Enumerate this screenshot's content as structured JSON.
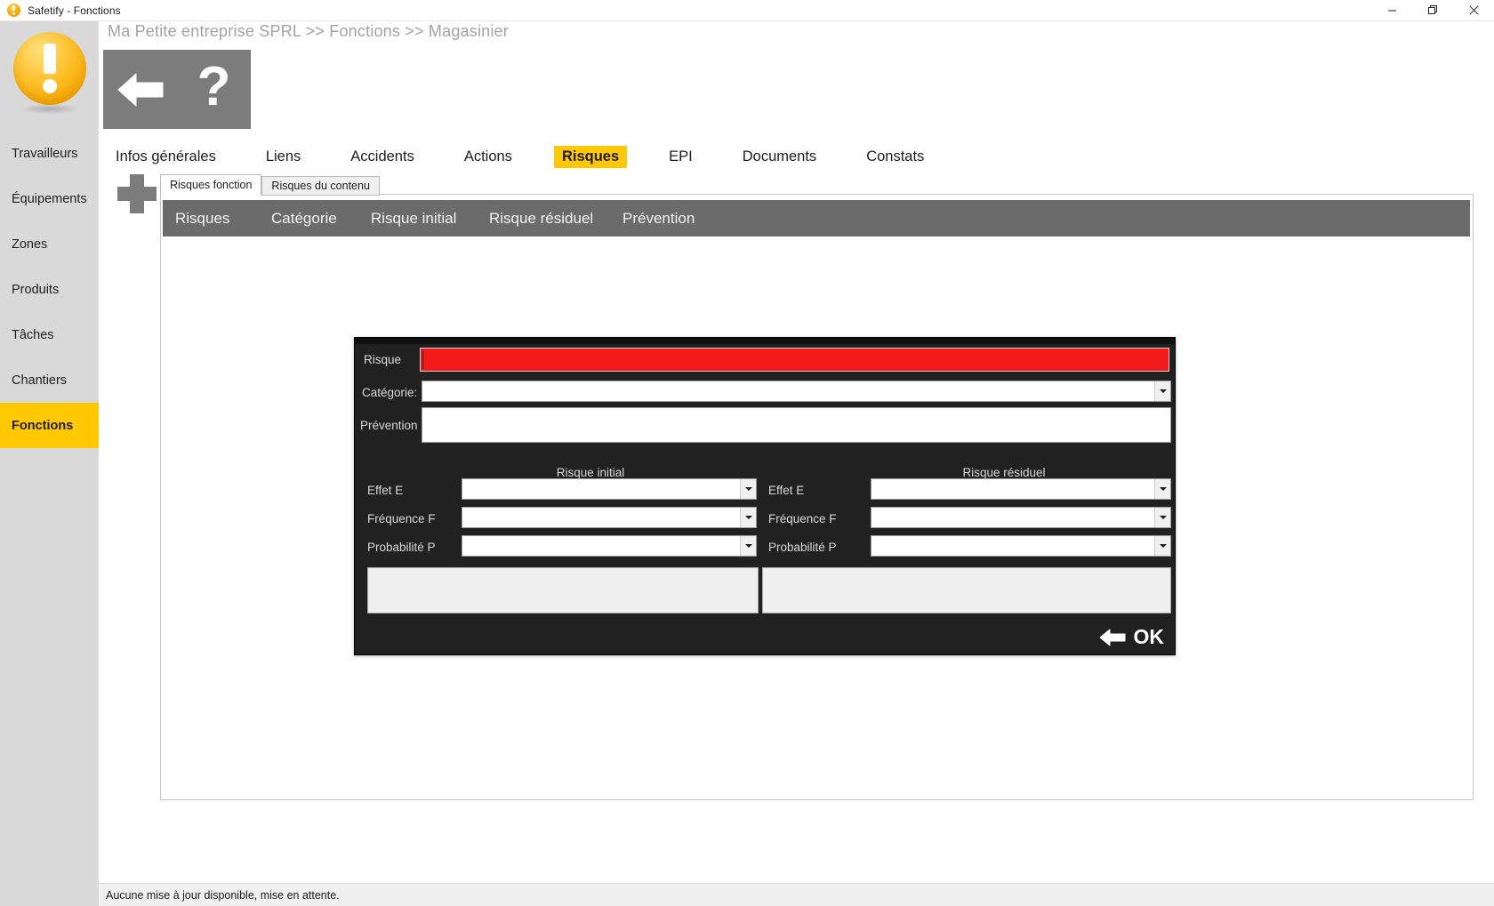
{
  "window": {
    "title": "Safetify - Fonctions",
    "icon": "safetify-logo-icon",
    "minimize_label": "Minimiser",
    "restore_label": "Restaurer",
    "close_label": "Fermer"
  },
  "header": {
    "breadcrumb": "Ma Petite entreprise SPRL >> Fonctions >> Magasinier",
    "back_icon": "back-arrow-icon",
    "help_icon": "question-mark-icon",
    "help_label": "?"
  },
  "sidebar": {
    "items": [
      {
        "label": "Travailleurs",
        "active": false
      },
      {
        "label": "Équipements",
        "active": false
      },
      {
        "label": "Zones",
        "active": false
      },
      {
        "label": "Produits",
        "active": false
      },
      {
        "label": "Tâches",
        "active": false
      },
      {
        "label": "Chantiers",
        "active": false
      },
      {
        "label": "Fonctions",
        "active": true
      }
    ]
  },
  "tabs": [
    {
      "label": "Infos générales",
      "active": false
    },
    {
      "label": "Liens",
      "active": false
    },
    {
      "label": "Accidents",
      "active": false
    },
    {
      "label": "Actions",
      "active": false
    },
    {
      "label": "Risques",
      "active": true
    },
    {
      "label": "EPI",
      "active": false
    },
    {
      "label": "Documents",
      "active": false
    },
    {
      "label": "Constats",
      "active": false
    }
  ],
  "subtabs": [
    {
      "label": "Risques fonction",
      "active": true
    },
    {
      "label": "Risques du contenu",
      "active": false
    }
  ],
  "add_button": {
    "icon": "plus-icon",
    "label": "Ajouter"
  },
  "grid": {
    "columns": [
      "Risques",
      "Catégorie",
      "Risque initial",
      "Risque résiduel",
      "Prévention"
    ],
    "rows": []
  },
  "dialog": {
    "risque": {
      "label": "Risque",
      "value": "",
      "state": "error",
      "error_color": "#f21a1a"
    },
    "categorie": {
      "label": "Catégorie:",
      "value": "",
      "icon": "chevron-down-icon"
    },
    "prevention": {
      "label": "Prévention",
      "value": ""
    },
    "initial": {
      "title": "Risque initial",
      "fields": [
        {
          "label": "Effet E",
          "value": "",
          "icon": "chevron-down-icon"
        },
        {
          "label": "Fréquence F",
          "value": "",
          "icon": "chevron-down-icon"
        },
        {
          "label": "Probabilité P",
          "value": "",
          "icon": "chevron-down-icon"
        }
      ],
      "result": ""
    },
    "residuel": {
      "title": "Risque résiduel",
      "fields": [
        {
          "label": "Effet E",
          "value": "",
          "icon": "chevron-down-icon"
        },
        {
          "label": "Fréquence F",
          "value": "",
          "icon": "chevron-down-icon"
        },
        {
          "label": "Probabilité P",
          "value": "",
          "icon": "chevron-down-icon"
        }
      ],
      "result": ""
    },
    "ok_button": {
      "label": "OK",
      "icon": "back-arrow-icon"
    }
  },
  "statusbar": {
    "message": "Aucune mise à jour disponible, mise en attente."
  },
  "colors": {
    "accent_yellow": "#ffc800",
    "sidebar_bg": "#d9d9d9",
    "toolbar_gray": "#7c7c7c",
    "grid_header": "#6b6b6b",
    "dialog_bg": "#212121",
    "error_red": "#f21a1a"
  }
}
